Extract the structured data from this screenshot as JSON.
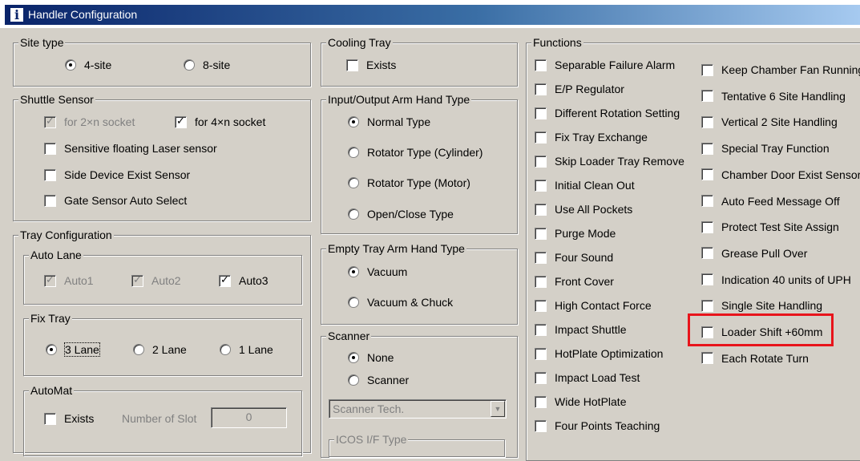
{
  "window": {
    "title": "Handler Configuration",
    "icon": "info-icon"
  },
  "site_type": {
    "legend": "Site type",
    "options": [
      {
        "label": "4-site",
        "selected": true
      },
      {
        "label": "8-site",
        "selected": false
      }
    ]
  },
  "shuttle_sensor": {
    "legend": "Shuttle Sensor",
    "for_2xn": {
      "label": "for 2×n socket",
      "checked": true,
      "disabled": true
    },
    "for_4xn": {
      "label": "for 4×n socket",
      "checked": true
    },
    "sensitive_laser": {
      "label": "Sensitive floating Laser sensor",
      "checked": false
    },
    "side_device": {
      "label": "Side Device Exist Sensor",
      "checked": false
    },
    "gate_sensor": {
      "label": "Gate Sensor Auto Select",
      "checked": false
    }
  },
  "tray_configuration": {
    "legend": "Tray Configuration",
    "auto_lane": {
      "legend": "Auto Lane",
      "auto1": {
        "label": "Auto1",
        "checked": true,
        "disabled": true
      },
      "auto2": {
        "label": "Auto2",
        "checked": true,
        "disabled": true
      },
      "auto3": {
        "label": "Auto3",
        "checked": true
      }
    },
    "fix_tray": {
      "legend": "Fix Tray",
      "options": [
        {
          "label": "3 Lane",
          "selected": true
        },
        {
          "label": "2 Lane",
          "selected": false
        },
        {
          "label": "1 Lane",
          "selected": false
        }
      ]
    },
    "automat": {
      "legend": "AutoMat",
      "exists": {
        "label": "Exists",
        "checked": false
      },
      "slot_label": "Number of Slot",
      "slot_value": "0"
    }
  },
  "cooling_tray": {
    "legend": "Cooling Tray",
    "exists": {
      "label": "Exists",
      "checked": false
    }
  },
  "io_arm": {
    "legend": "Input/Output Arm Hand Type",
    "options": [
      {
        "label": "Normal Type",
        "selected": true
      },
      {
        "label": "Rotator Type (Cylinder)",
        "selected": false
      },
      {
        "label": "Rotator Type (Motor)",
        "selected": false
      },
      {
        "label": "Open/Close Type",
        "selected": false
      }
    ]
  },
  "empty_tray_arm": {
    "legend": "Empty Tray Arm Hand Type",
    "options": [
      {
        "label": "Vacuum",
        "selected": true
      },
      {
        "label": "Vacuum & Chuck",
        "selected": false
      }
    ]
  },
  "scanner": {
    "legend": "Scanner",
    "options": [
      {
        "label": "None",
        "selected": true
      },
      {
        "label": "Scanner",
        "selected": false
      }
    ],
    "combo_value": "Scanner Tech.",
    "icos_legend": "ICOS I/F Type"
  },
  "functions": {
    "legend": "Functions",
    "col1": [
      "Separable Failure Alarm",
      "E/P Regulator",
      "Different Rotation Setting",
      "Fix Tray Exchange",
      "Skip Loader Tray Remove",
      "Initial Clean Out",
      "Use All Pockets",
      "Purge Mode",
      "Four Sound",
      "Front Cover",
      "High Contact Force",
      "Impact Shuttle",
      "HotPlate Optimization",
      "Impact Load Test",
      "Wide HotPlate",
      "Four Points Teaching"
    ],
    "col2": [
      "Keep Chamber Fan Running",
      "Tentative 6 Site Handling",
      "Vertical 2 Site Handling",
      "Special Tray Function",
      "Chamber Door Exist Sensor",
      "Auto Feed Message Off",
      "Protect Test Site Assign",
      "Grease Pull Over",
      "Indication 40 units of UPH",
      "Single Site Handling",
      "Loader Shift +60mm",
      "Each Rotate Turn"
    ]
  },
  "highlight": {
    "color": "#e8141b",
    "target": "Loader Shift +60mm"
  }
}
